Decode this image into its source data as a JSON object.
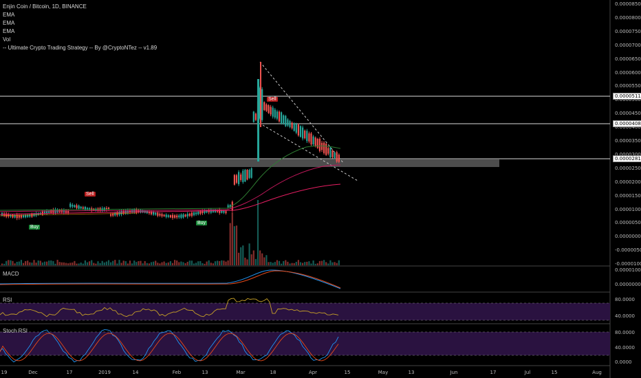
{
  "header": {
    "title": "Enjin Coin / Bitcoin, 1D, BINANCE",
    "studies": [
      "EMA",
      "EMA",
      "EMA",
      "Vol",
      "-- Ultimate Crypto Trading Strategy -- By @CryptoNTez -- v1.89"
    ]
  },
  "price_axis": {
    "ticks": [
      "0.00008500",
      "0.00008000",
      "0.00007500",
      "0.00007000",
      "0.00006500",
      "0.00006000",
      "0.00005500",
      "0.00005000",
      "0.00004500",
      "0.00004000",
      "0.00003500",
      "0.00003000",
      "0.00002500",
      "0.00002000",
      "0.00001500",
      "0.00001000",
      "0.00000500",
      "0.00000000",
      "-0.00000500",
      "-0.00001000"
    ],
    "highlighted": [
      "0.00005113",
      "0.00004082",
      "0.00002811"
    ]
  },
  "markers": {
    "sell": "Sell",
    "buy": "Buy"
  },
  "panes": {
    "macd": {
      "name": "MACD",
      "ticks": [
        "0.00001000",
        "0.00000000"
      ]
    },
    "rsi": {
      "name": "RSI",
      "ticks": [
        "80.0000",
        "40.0000"
      ]
    },
    "stoch": {
      "name": "Stoch RSI",
      "ticks": [
        "80.0000",
        "40.0000",
        "0.0000"
      ]
    }
  },
  "time_axis": [
    "19",
    "Dec",
    "17",
    "2019",
    "14",
    "Feb",
    "13",
    "Mar",
    "18",
    "Apr",
    "15",
    "May",
    "13",
    "Jun",
    "17",
    "Jul",
    "15",
    "Aug"
  ],
  "colors": {
    "up": "#26a69a",
    "down": "#ef5350",
    "ema_fast": "#2e7d32",
    "ema_mid": "#c2185b",
    "ema_slow": "#e91e63",
    "rsi": "#c9a227",
    "band": "#2a1240"
  }
}
